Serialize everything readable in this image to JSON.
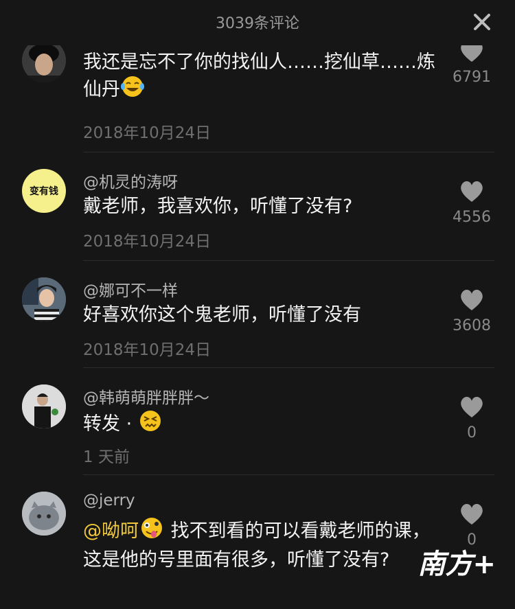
{
  "header": {
    "title": "3039条评论",
    "close_icon": "close-icon"
  },
  "comments": [
    {
      "name": "",
      "text": "我还是忘不了你的找仙人……挖仙草……炼仙丹",
      "emoji": "laughing-crying-emoji",
      "time": "2018年10月24日",
      "likes": "6791"
    },
    {
      "name": "@机灵的涛呀",
      "avatar_text": "变有钱",
      "text": "戴老师，我喜欢你，听懂了没有?",
      "time": "2018年10月24日",
      "likes": "4556"
    },
    {
      "name": "@娜可不一样",
      "text": "好喜欢你这个鬼老师，听懂了没有",
      "time": "2018年10月24日",
      "likes": "3608"
    },
    {
      "name": "@韩萌萌胖胖胖～",
      "text": "转发 · ",
      "emoji": "confounded-face-emoji",
      "time": "1 天前",
      "likes": "0"
    },
    {
      "name": "@jerry",
      "mention": "@呦呵",
      "emoji": "zany-face-emoji",
      "text": "找不到看的可以看戴老师的课，这是他的号里面有很多，听懂了没有?",
      "time": "",
      "likes": "0"
    }
  ],
  "watermark": "南方+",
  "colors": {
    "background": "#161616",
    "mention": "#f0c83a",
    "avatar_yellow": "#f6f08c"
  }
}
